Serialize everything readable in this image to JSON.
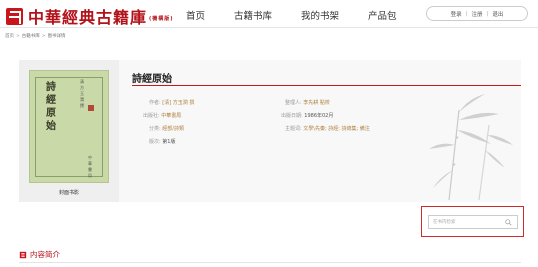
{
  "header": {
    "logo_text": "中華經典古籍庫",
    "logo_sub": "(機構版)",
    "nav": [
      "首页",
      "古籍书库",
      "我的书架",
      "产品包"
    ],
    "auth": [
      "登录",
      "注册",
      "退出"
    ]
  },
  "breadcrumb": [
    "首页",
    "古籍书库",
    "图书详情"
  ],
  "book": {
    "title": "詩經原始",
    "cover_label": "封面书影",
    "cover_art": {
      "title_vertical": "詩經原始",
      "side_text": "清方玉潤撰",
      "publisher": "中華書局"
    },
    "meta": {
      "author_label": "作者:",
      "author_value": "[清] 方玉潤 撰",
      "publisher_label": "出版社:",
      "publisher_value": "中華書局",
      "category_label": "分类:",
      "category_value": "經部/詩類",
      "edition_label": "版次:",
      "edition_value": "第1版",
      "editor_label": "整理人:",
      "editor_value": "李先耕 點校",
      "date_label": "出版日期:",
      "date_value": "1986年02月",
      "keywords_label": "主题词:",
      "keywords_value": "文學\\先秦; 詩經; 詩總集; 備注"
    }
  },
  "search": {
    "placeholder": "在书内检索"
  },
  "intro": {
    "title": "内容简介"
  },
  "colors": {
    "brand_red": "#c8161d",
    "cover_green": "#c9d9a8"
  }
}
